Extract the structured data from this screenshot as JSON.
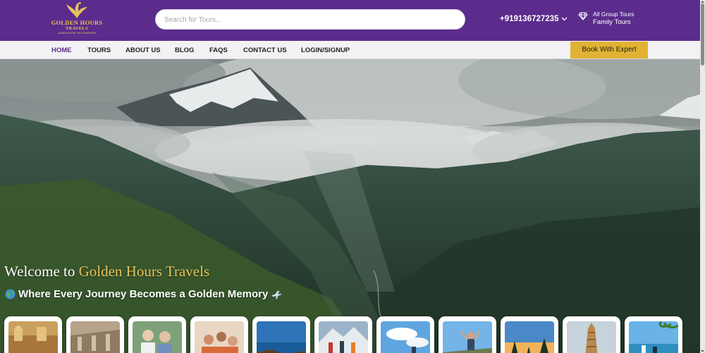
{
  "header": {
    "logo": {
      "name_line1": "GOLDEN HOURS",
      "name_line2": "TRAVELS",
      "tagline": "JANA HAI PAL HO SUNEHRA"
    },
    "search_placeholder": "Search for Tours...",
    "phone": "+919136727235",
    "tours_line1": "All Group Tours",
    "tours_line2": "Family Tours",
    "icons": {
      "logo": "bird-icon",
      "phone_dropdown": "chevron-down-icon",
      "tours": "diamond-icon"
    }
  },
  "nav": {
    "items": [
      {
        "label": "HOME",
        "active": true
      },
      {
        "label": "TOURS",
        "active": false
      },
      {
        "label": "ABOUT US",
        "active": false
      },
      {
        "label": "BLOG",
        "active": false
      },
      {
        "label": "FAQS",
        "active": false
      },
      {
        "label": "CONTACT US",
        "active": false
      },
      {
        "label": "LOGIN/SIGNUP",
        "active": false
      }
    ],
    "cta_label": "Book With Expert"
  },
  "hero": {
    "title_prefix": "Welcome to ",
    "title_highlight": "Golden Hours Travels",
    "subtitle": "Where Every Journey Becomes a Golden Memory",
    "subtitle_icons": [
      "globe-icon",
      "airplane-icon"
    ]
  },
  "tour_cards": [
    {
      "name": "palace-card"
    },
    {
      "name": "ruins-card"
    },
    {
      "name": "couple-card"
    },
    {
      "name": "friends-card"
    },
    {
      "name": "beach-card"
    },
    {
      "name": "mountain-group-card"
    },
    {
      "name": "sky-card"
    },
    {
      "name": "hiker-card"
    },
    {
      "name": "pine-sunset-card"
    },
    {
      "name": "temple-card"
    },
    {
      "name": "palm-beach-card"
    }
  ],
  "colors": {
    "header_purple": "#5b2c8c",
    "gold": "#e7c35a",
    "cta_gold": "#e1b233",
    "nav_bg": "#f2f2f5"
  }
}
